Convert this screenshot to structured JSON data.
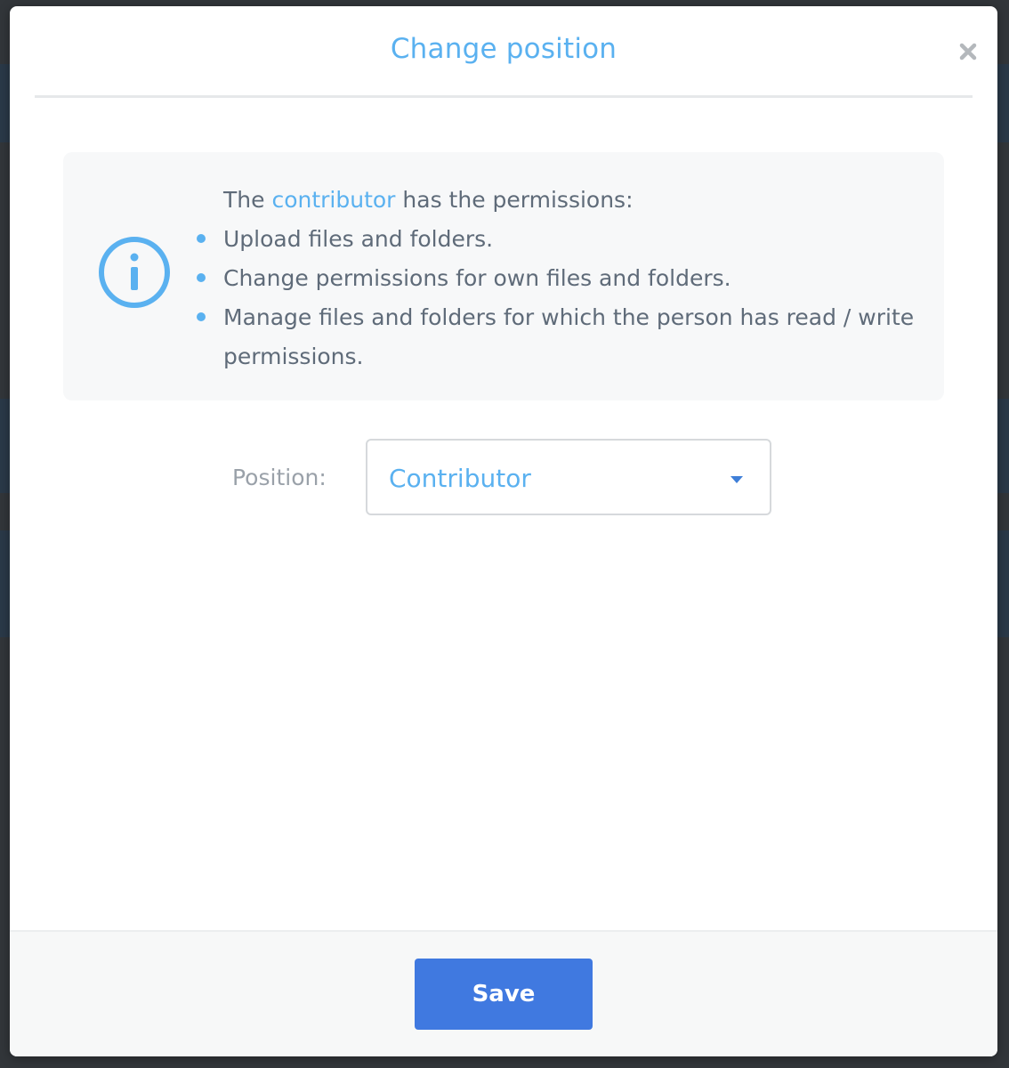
{
  "modal": {
    "title": "Change position",
    "close_symbol": "×"
  },
  "info": {
    "icon": "info-icon",
    "intro_prefix": "The ",
    "role": "contributor",
    "intro_suffix": " has the permissions:",
    "permissions": [
      "Upload files and folders.",
      "Change permissions for own files and folders.",
      "Manage files and folders for which the person has read / write permissions."
    ]
  },
  "position": {
    "label": "Position:",
    "selected": "Contributor"
  },
  "footer": {
    "save_label": "Save"
  },
  "colors": {
    "accent": "#5ab1f0",
    "primary_button": "#4079e0",
    "text": "#5f6b79",
    "muted": "#9aa1a9"
  }
}
